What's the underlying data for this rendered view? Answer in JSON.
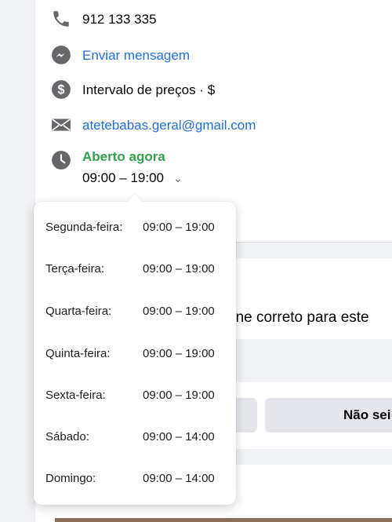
{
  "contact": {
    "phone": "912 133 335",
    "message_link": "Enviar mensagem",
    "price_range": "Intervalo de preços · $",
    "email": "atetebabas.geral@gmail.com",
    "status": "Aberto agora",
    "today_hours": "09:00 – 19:00"
  },
  "hours": [
    {
      "day": "Segunda-feira:",
      "time": "09:00 – 19:00"
    },
    {
      "day": "Terça-feira:",
      "time": "09:00 – 19:00"
    },
    {
      "day": "Quarta-feira:",
      "time": "09:00 – 19:00"
    },
    {
      "day": "Quinta-feira:",
      "time": "09:00 – 19:00"
    },
    {
      "day": "Sexta-feira:",
      "time": "09:00 – 19:00"
    },
    {
      "day": "Sábado:",
      "time": "09:00 – 14:00"
    },
    {
      "day": "Domingo:",
      "time": "09:00 – 14:00"
    }
  ],
  "feedback": {
    "question_partial": "one correto para este",
    "unsure_button": "Não sei"
  },
  "colors": {
    "link": "#216fdb",
    "open_status": "#31a24c",
    "icon": "#65676b"
  }
}
